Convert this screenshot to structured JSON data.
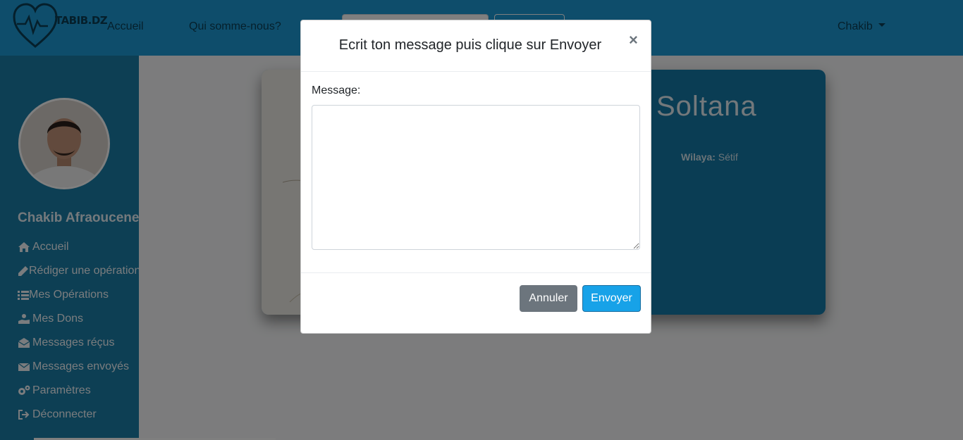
{
  "navbar": {
    "brand": "TABIB.DZ",
    "links": [
      "Accueil",
      "Qui somme-nous?"
    ],
    "user": "Chakib"
  },
  "sidebar": {
    "name": "Chakib Afraoucene",
    "items": [
      {
        "label": "Accueil",
        "icon": "home-icon"
      },
      {
        "label": "Rédiger une opération",
        "icon": "pen-icon"
      },
      {
        "label": "Mes Opérations",
        "icon": "list-icon"
      },
      {
        "label": "Mes Dons",
        "icon": "hand-holding-icon"
      },
      {
        "label": "Messages réçus",
        "icon": "envelope-open-icon"
      },
      {
        "label": "Messages envoyés",
        "icon": "envelope-icon"
      },
      {
        "label": "Paramètres",
        "icon": "gears-icon"
      },
      {
        "label": "Déconnecter",
        "icon": "sign-out-icon"
      }
    ]
  },
  "card": {
    "title": "Soltana",
    "wilaya_label": "Wilaya:",
    "wilaya_value": "Sétif"
  },
  "modal": {
    "title": "Ecrit ton message puis clique sur Envoyer",
    "close": "×",
    "message_label": "Message:",
    "message_value": "",
    "cancel_label": "Annuler",
    "send_label": "Envoyer"
  },
  "colors": {
    "navbar": "#1d9bd6",
    "sidebar": "#1a7ea8",
    "send_button": "#17a2e8",
    "cancel_button": "#6c757d"
  }
}
